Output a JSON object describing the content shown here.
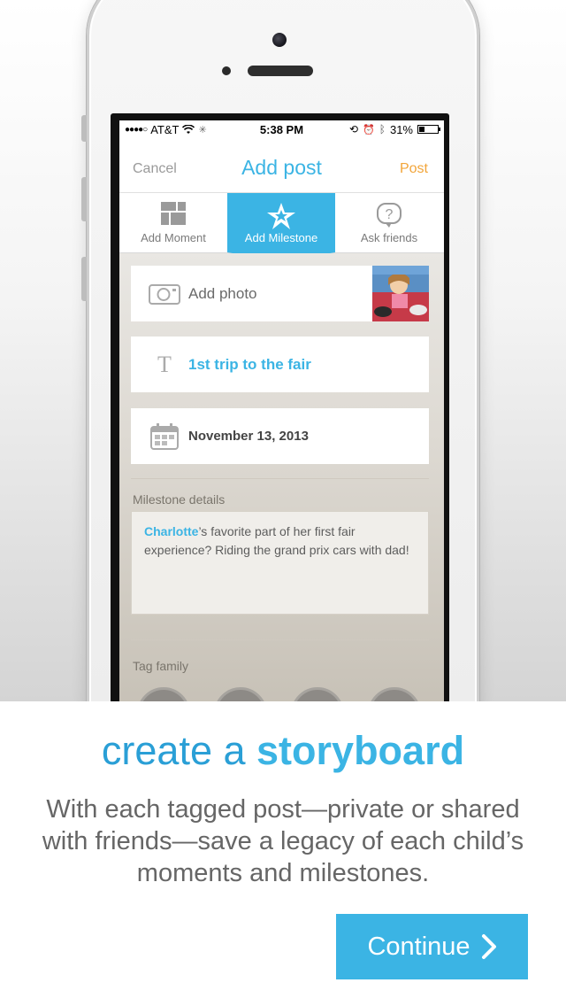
{
  "status_bar": {
    "signal": "●●●●○",
    "carrier": "AT&T",
    "time": "5:38 PM",
    "battery_pct": "31%",
    "battery_level": 0.31
  },
  "nav": {
    "cancel": "Cancel",
    "title": "Add post",
    "post": "Post"
  },
  "tabs": [
    {
      "label": "Add Moment",
      "icon": "grid-icon"
    },
    {
      "label": "Add Milestone",
      "icon": "star-icon",
      "active": true
    },
    {
      "label": "Ask friends",
      "icon": "question-bubble-icon"
    }
  ],
  "form": {
    "add_photo": "Add photo",
    "title_value": "1st trip to the fair",
    "title_icon_glyph": "T",
    "date_value": "November 13, 2013",
    "details_label": "Milestone details",
    "details_name": "Charlotte",
    "details_text": "’s favorite part of her first fair experience?  Riding the grand prix cars with dad!",
    "tag_label": "Tag family"
  },
  "promo": {
    "headline_prefix": "create a ",
    "headline_strong": "storyboard",
    "body": "With each tagged post—private or shared with friends—save a legacy of each child’s moments and milestones.",
    "continue": "Continue"
  },
  "colors": {
    "accent_blue": "#3bb4e4",
    "post_orange": "#f2a53a",
    "headline_blue": "#2a9fd6"
  }
}
